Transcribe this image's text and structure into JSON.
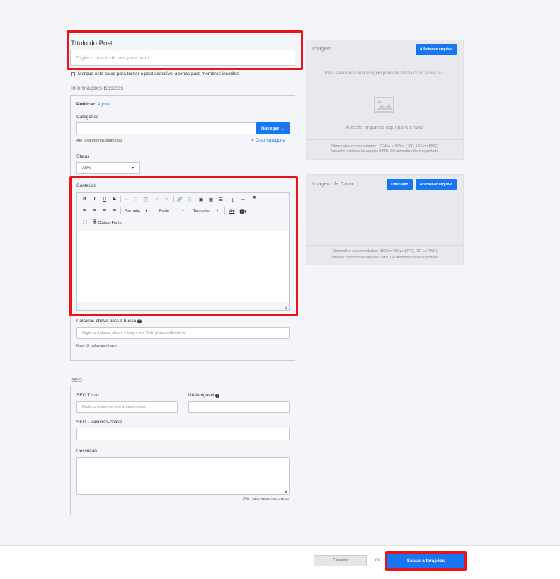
{
  "post": {
    "title_label": "Título do Post",
    "title_placeholder": "Digite o nome de seu post aqui.",
    "members_only_label": "Marque esta caixa para tornar o post acessível apenas para membros inscritos"
  },
  "basic_info": {
    "section_title": "Informações Básicas",
    "publish_label": "Publicar:",
    "publish_value": "Agora",
    "categories_label": "Categorias",
    "navigate_button": "Navegar",
    "categories_hint": "Até 5 categorias atribuídas",
    "create_category": "Criar categoria",
    "status_label": "Status",
    "status_value": "Ativo",
    "content_label": "Conteúdo",
    "editor": {
      "format_dropdown": "Formata...",
      "font_dropdown": "Fonte",
      "size_dropdown": "Tamanho",
      "source_button": "Código-Fonte",
      "bold": "B",
      "italic": "I",
      "underline": "U",
      "strike": "S"
    },
    "keywords_label": "Palavras-chave para a busca",
    "keywords_placeholder": "Digite a palavra-chave e toque em 'Tab' para confirmá-la.",
    "keywords_hint": "Max 10 palavras-chave"
  },
  "seo": {
    "section_title": "SEO",
    "title_label": "SEO Título",
    "title_placeholder": "Digite o nome de seu anúncio aqui.",
    "url_label": "Url Amigável",
    "keywords_label": "SEO - Palavras-chave",
    "description_label": "Descrição",
    "chars_remaining": "250 caracteres restantes"
  },
  "image_panel": {
    "title": "Imagem",
    "add_button": "Adicionar arquivo",
    "instruction": "Para selecionar uma imagem principal, basta clicar sobre ela.",
    "drop_text": "Arraste arquivos aqui para enviar",
    "dims_line1": "Dimensões recomendadas: 1024px x 768px (JPG, GIF ou PNG)",
    "dims_line2": "Tamanho máximo do arquivo 2 MB. Gif animado não é suportado."
  },
  "cover_panel": {
    "title": "Imagem de Capa",
    "unsplash_button": "Unsplash",
    "add_button": "Adicionar arquivo",
    "dims_line1": "Dimensões recomendadas : 1920 x 480 px (JPG, GIF ou PNG)",
    "dims_line2": "Tamanho máximo do arquivo 2 MB. Gif animado não é suportado."
  },
  "footer": {
    "cancel_button": "Cancelar",
    "or_text": "ou",
    "save_button": "Salvar alterações"
  },
  "colors": {
    "accent": "#1976f2",
    "highlight": "#e8141a"
  }
}
